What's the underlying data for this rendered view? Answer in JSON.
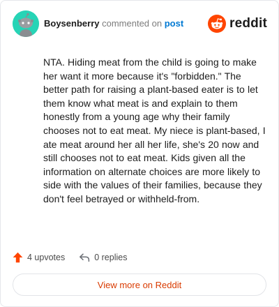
{
  "comment": {
    "author": "Boysenberry",
    "action_text": "commented on",
    "post_link": "post",
    "body": "NTA. Hiding meat from the child is going to make her want it more because it's \"forbidden.\" The better path for raising a plant-based eater is to let them know what meat is and explain to them honestly from a young age why their family chooses not to eat meat. My niece is plant-based, I ate meat around her all her life, she's 20 now and still chooses not to eat meat. Kids given all the information on alternate choices are more likely to side with the values of their families, because they don't feel betrayed or withheld-from."
  },
  "brand": {
    "name": "reddit",
    "color": "#ff4500"
  },
  "stats": {
    "upvotes": "4 upvotes",
    "replies": "0 replies"
  },
  "footer": {
    "view_more_label": "View more on Reddit"
  },
  "icons": {
    "avatar": "snoo-avatar-icon",
    "logo": "reddit-logo-icon",
    "upvote": "upvote-arrow-icon",
    "reply": "reply-arrow-icon"
  }
}
